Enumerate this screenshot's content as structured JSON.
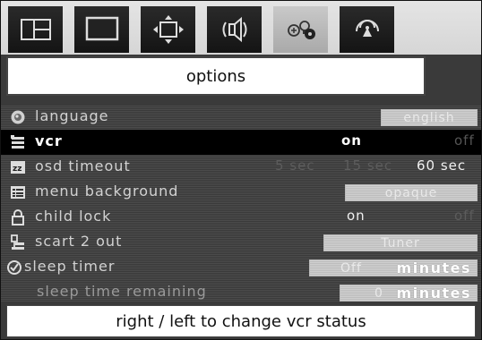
{
  "tabs": [
    {
      "name": "picture-size-tab",
      "icon": "split-screen-icon",
      "active": false
    },
    {
      "name": "picture-tab",
      "icon": "monitor-icon",
      "active": false
    },
    {
      "name": "geometry-tab",
      "icon": "geometry-arrows-icon",
      "active": false
    },
    {
      "name": "sound-tab",
      "icon": "speaker-icon",
      "active": false
    },
    {
      "name": "options-tab",
      "icon": "options-bulbs-icon",
      "active": true
    },
    {
      "name": "install-tab",
      "icon": "antenna-icon",
      "active": false
    }
  ],
  "title": "options",
  "menu": {
    "language": {
      "label": "language",
      "value": "english"
    },
    "vcr": {
      "label": "vcr",
      "options": [
        "on",
        "off"
      ],
      "selected": "on"
    },
    "osd_timeout": {
      "label": "osd timeout",
      "options": [
        "5 sec",
        "15 sec",
        "60 sec"
      ],
      "selected": "60 sec"
    },
    "menu_background": {
      "label": "menu background",
      "value": "opaque"
    },
    "child_lock": {
      "label": "child lock",
      "options": [
        "on",
        "off"
      ],
      "selected": "on"
    },
    "scart2": {
      "label": "scart 2 out",
      "value": "Tuner"
    },
    "sleep_timer": {
      "label": "sleep timer",
      "value": "Off",
      "unit": "minutes"
    },
    "sleep_remaining": {
      "label": "sleep time remaining",
      "value": "0",
      "unit": "minutes"
    }
  },
  "status": "right / left to change vcr status",
  "colors": {
    "selected_row": "#000000",
    "panel": "#3a3a3a",
    "active_tab": "#b9b9b9"
  }
}
